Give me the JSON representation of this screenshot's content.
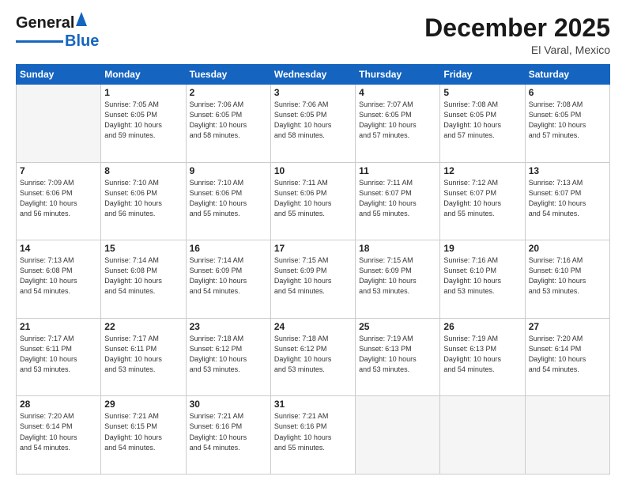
{
  "header": {
    "logo_general": "General",
    "logo_blue": "Blue",
    "month": "December 2025",
    "location": "El Varal, Mexico"
  },
  "weekdays": [
    "Sunday",
    "Monday",
    "Tuesday",
    "Wednesday",
    "Thursday",
    "Friday",
    "Saturday"
  ],
  "weeks": [
    [
      {
        "day": "",
        "info": ""
      },
      {
        "day": "1",
        "info": "Sunrise: 7:05 AM\nSunset: 6:05 PM\nDaylight: 10 hours\nand 59 minutes."
      },
      {
        "day": "2",
        "info": "Sunrise: 7:06 AM\nSunset: 6:05 PM\nDaylight: 10 hours\nand 58 minutes."
      },
      {
        "day": "3",
        "info": "Sunrise: 7:06 AM\nSunset: 6:05 PM\nDaylight: 10 hours\nand 58 minutes."
      },
      {
        "day": "4",
        "info": "Sunrise: 7:07 AM\nSunset: 6:05 PM\nDaylight: 10 hours\nand 57 minutes."
      },
      {
        "day": "5",
        "info": "Sunrise: 7:08 AM\nSunset: 6:05 PM\nDaylight: 10 hours\nand 57 minutes."
      },
      {
        "day": "6",
        "info": "Sunrise: 7:08 AM\nSunset: 6:05 PM\nDaylight: 10 hours\nand 57 minutes."
      }
    ],
    [
      {
        "day": "7",
        "info": "Sunrise: 7:09 AM\nSunset: 6:06 PM\nDaylight: 10 hours\nand 56 minutes."
      },
      {
        "day": "8",
        "info": "Sunrise: 7:10 AM\nSunset: 6:06 PM\nDaylight: 10 hours\nand 56 minutes."
      },
      {
        "day": "9",
        "info": "Sunrise: 7:10 AM\nSunset: 6:06 PM\nDaylight: 10 hours\nand 55 minutes."
      },
      {
        "day": "10",
        "info": "Sunrise: 7:11 AM\nSunset: 6:06 PM\nDaylight: 10 hours\nand 55 minutes."
      },
      {
        "day": "11",
        "info": "Sunrise: 7:11 AM\nSunset: 6:07 PM\nDaylight: 10 hours\nand 55 minutes."
      },
      {
        "day": "12",
        "info": "Sunrise: 7:12 AM\nSunset: 6:07 PM\nDaylight: 10 hours\nand 55 minutes."
      },
      {
        "day": "13",
        "info": "Sunrise: 7:13 AM\nSunset: 6:07 PM\nDaylight: 10 hours\nand 54 minutes."
      }
    ],
    [
      {
        "day": "14",
        "info": "Sunrise: 7:13 AM\nSunset: 6:08 PM\nDaylight: 10 hours\nand 54 minutes."
      },
      {
        "day": "15",
        "info": "Sunrise: 7:14 AM\nSunset: 6:08 PM\nDaylight: 10 hours\nand 54 minutes."
      },
      {
        "day": "16",
        "info": "Sunrise: 7:14 AM\nSunset: 6:09 PM\nDaylight: 10 hours\nand 54 minutes."
      },
      {
        "day": "17",
        "info": "Sunrise: 7:15 AM\nSunset: 6:09 PM\nDaylight: 10 hours\nand 54 minutes."
      },
      {
        "day": "18",
        "info": "Sunrise: 7:15 AM\nSunset: 6:09 PM\nDaylight: 10 hours\nand 53 minutes."
      },
      {
        "day": "19",
        "info": "Sunrise: 7:16 AM\nSunset: 6:10 PM\nDaylight: 10 hours\nand 53 minutes."
      },
      {
        "day": "20",
        "info": "Sunrise: 7:16 AM\nSunset: 6:10 PM\nDaylight: 10 hours\nand 53 minutes."
      }
    ],
    [
      {
        "day": "21",
        "info": "Sunrise: 7:17 AM\nSunset: 6:11 PM\nDaylight: 10 hours\nand 53 minutes."
      },
      {
        "day": "22",
        "info": "Sunrise: 7:17 AM\nSunset: 6:11 PM\nDaylight: 10 hours\nand 53 minutes."
      },
      {
        "day": "23",
        "info": "Sunrise: 7:18 AM\nSunset: 6:12 PM\nDaylight: 10 hours\nand 53 minutes."
      },
      {
        "day": "24",
        "info": "Sunrise: 7:18 AM\nSunset: 6:12 PM\nDaylight: 10 hours\nand 53 minutes."
      },
      {
        "day": "25",
        "info": "Sunrise: 7:19 AM\nSunset: 6:13 PM\nDaylight: 10 hours\nand 53 minutes."
      },
      {
        "day": "26",
        "info": "Sunrise: 7:19 AM\nSunset: 6:13 PM\nDaylight: 10 hours\nand 54 minutes."
      },
      {
        "day": "27",
        "info": "Sunrise: 7:20 AM\nSunset: 6:14 PM\nDaylight: 10 hours\nand 54 minutes."
      }
    ],
    [
      {
        "day": "28",
        "info": "Sunrise: 7:20 AM\nSunset: 6:14 PM\nDaylight: 10 hours\nand 54 minutes."
      },
      {
        "day": "29",
        "info": "Sunrise: 7:21 AM\nSunset: 6:15 PM\nDaylight: 10 hours\nand 54 minutes."
      },
      {
        "day": "30",
        "info": "Sunrise: 7:21 AM\nSunset: 6:16 PM\nDaylight: 10 hours\nand 54 minutes."
      },
      {
        "day": "31",
        "info": "Sunrise: 7:21 AM\nSunset: 6:16 PM\nDaylight: 10 hours\nand 55 minutes."
      },
      {
        "day": "",
        "info": ""
      },
      {
        "day": "",
        "info": ""
      },
      {
        "day": "",
        "info": ""
      }
    ]
  ]
}
